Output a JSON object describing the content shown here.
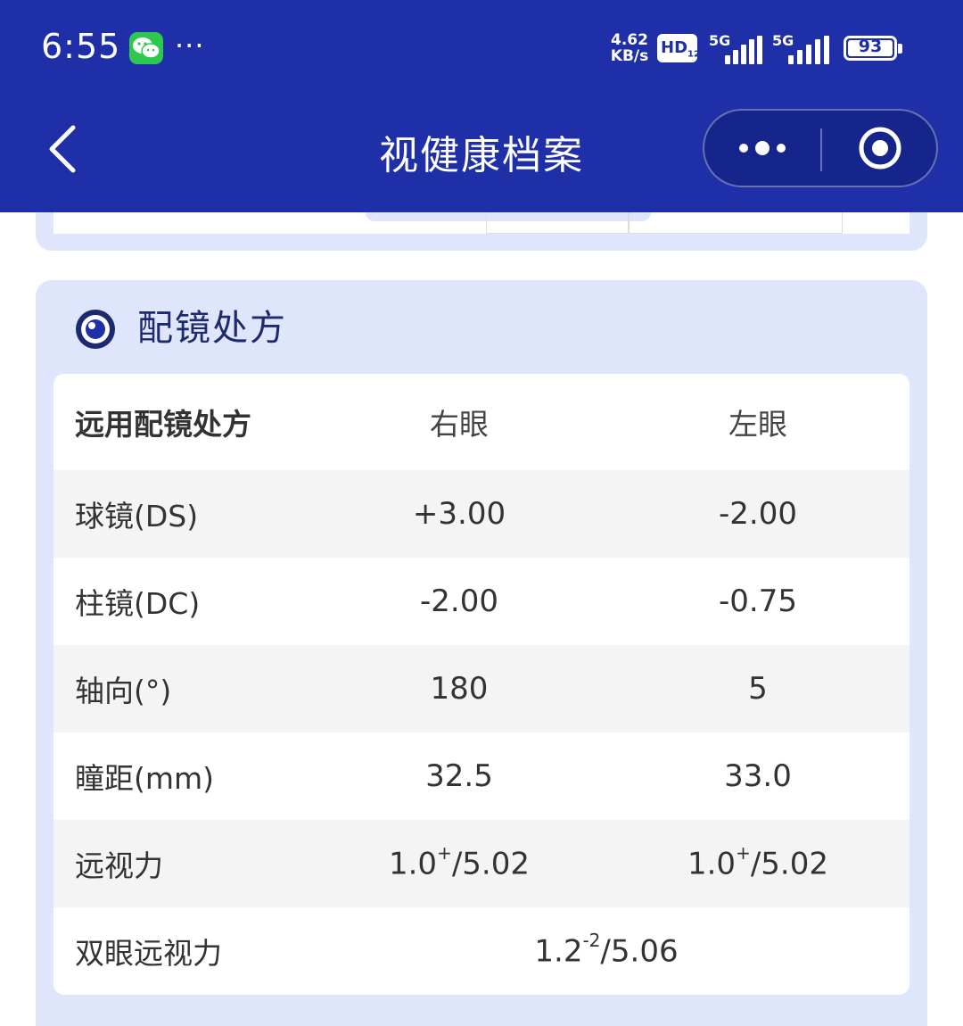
{
  "status_bar": {
    "time": "6:55",
    "more": "···",
    "net_speed_value": "4.62",
    "net_speed_unit": "KB/s",
    "hd_label": "HD",
    "hd_sub": "1",
    "hd_sub2": "2",
    "sim1_label": "5G",
    "sim2_label": "5G",
    "battery_percent": "93"
  },
  "nav": {
    "title": "视健康档案"
  },
  "prescription": {
    "section_title": "配镜处方",
    "header": {
      "label": "远用配镜处方",
      "right_eye": "右眼",
      "left_eye": "左眼"
    },
    "rows": [
      {
        "label": "球镜(DS)",
        "right": "+3.00",
        "left": "-2.00"
      },
      {
        "label": "柱镜(DC)",
        "right": "-2.00",
        "left": "-0.75"
      },
      {
        "label": "轴向(°)",
        "right": "180",
        "left": "5"
      },
      {
        "label": "瞳距(mm)",
        "right": "32.5",
        "left": "33.0"
      }
    ],
    "va_row": {
      "label": "远视力",
      "right_base": "1.0",
      "right_sup": "+",
      "right_tail": "/5.02",
      "left_base": "1.0",
      "left_sup": "+",
      "left_tail": "/5.02"
    },
    "binocular_row": {
      "label": "双眼远视力",
      "base": "1.2",
      "sup": "-2",
      "tail": "/5.06"
    }
  },
  "colors": {
    "primary": "#1e2fa8",
    "card_bg": "#dfe6fb",
    "wechat_green": "#2dc84d"
  },
  "icons": {
    "back": "chevron-left-icon",
    "menu": "more-dots-icon",
    "close": "target-circle-icon",
    "section": "eye-icon"
  }
}
